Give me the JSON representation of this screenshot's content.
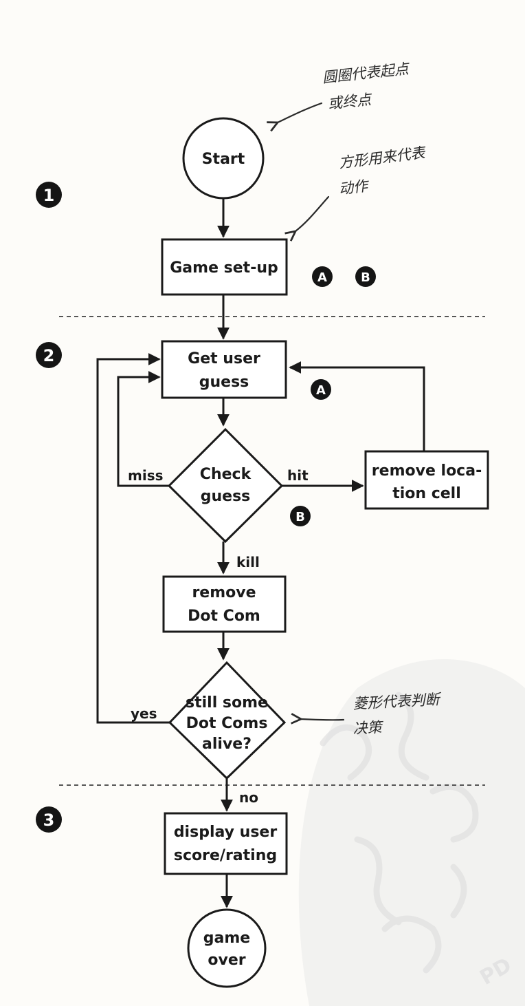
{
  "nodes": {
    "start": "Start",
    "setup": "Game set-up",
    "guess": [
      "Get user",
      "guess"
    ],
    "check": [
      "Check",
      "guess"
    ],
    "remove_cell": [
      "remove loca-",
      "tion cell"
    ],
    "remove_dotcom": [
      "remove",
      "Dot Com"
    ],
    "alive": [
      "still some",
      "Dot Coms",
      "alive?"
    ],
    "display": [
      "display user",
      "score/rating"
    ],
    "end": [
      "game",
      "over"
    ]
  },
  "edge_labels": {
    "miss": "miss",
    "hit": "hit",
    "kill": "kill",
    "yes": "yes",
    "no": "no"
  },
  "steps": [
    "1",
    "2",
    "3"
  ],
  "markers": {
    "setup_a": "A",
    "setup_b": "B",
    "guess_a": "A",
    "check_b": "B"
  },
  "notes": {
    "circle": [
      "圆圈代表起点",
      "或终点"
    ],
    "rect": [
      "方形用来代表",
      "动作"
    ],
    "diamond": [
      "菱形代表判断",
      "决策"
    ]
  },
  "watermark_text": "PD"
}
